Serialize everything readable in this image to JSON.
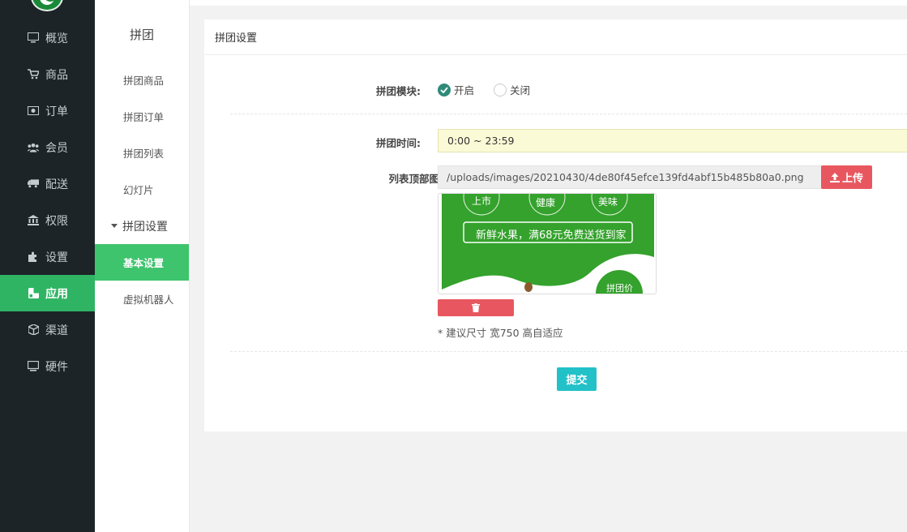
{
  "sidebar": {
    "items": [
      {
        "label": "概览",
        "icon": "monitor-icon"
      },
      {
        "label": "商品",
        "icon": "cart-icon"
      },
      {
        "label": "订单",
        "icon": "money-icon"
      },
      {
        "label": "会员",
        "icon": "users-icon"
      },
      {
        "label": "配送",
        "icon": "truck-icon"
      },
      {
        "label": "权限",
        "icon": "bank-icon"
      },
      {
        "label": "设置",
        "icon": "puzzle-icon"
      },
      {
        "label": "应用",
        "icon": "apps-icon"
      },
      {
        "label": "渠道",
        "icon": "cube-icon"
      },
      {
        "label": "硬件",
        "icon": "desktop-icon"
      }
    ],
    "active_index": 7
  },
  "subnav": {
    "title": "拼团",
    "items": [
      "拼团商品",
      "拼团订单",
      "拼团列表",
      "幻灯片"
    ],
    "group": "拼团设置",
    "group_items": [
      "基本设置",
      "虚拟机器人"
    ]
  },
  "panel": {
    "header": "拼团设置",
    "module_label": "拼团模块:",
    "radio_on": "开启",
    "radio_off": "关闭",
    "time_label": "拼团时间:",
    "time_value": "0:00 ~ 23:59",
    "banner_label": "列表顶部图:",
    "banner_path": "/uploads/images/20210430/4de80f45efce139fd4abf15b485b80a0.png",
    "upload_label": "上传",
    "hint": "* 建议尺寸 宽750 高自适应",
    "submit_label": "提交"
  },
  "preview": {
    "badges": [
      "上市",
      "健康",
      "美味"
    ],
    "slogan": "新鲜水果，满68元免费送货到家",
    "price_tag": "拼团价"
  },
  "colors": {
    "sidebar_bg": "#1c2428",
    "active_green": "#2fb463",
    "radio_on": "#2f8a78",
    "danger": "#e8575f",
    "submit": "#22c1c8",
    "banner_green": "#34a22c"
  }
}
